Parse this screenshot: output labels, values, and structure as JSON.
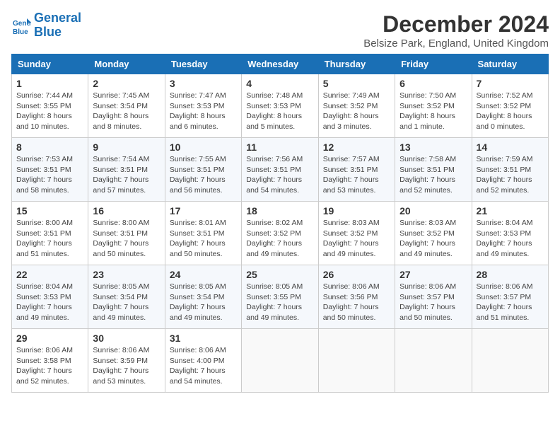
{
  "logo": {
    "line1": "General",
    "line2": "Blue"
  },
  "title": "December 2024",
  "subtitle": "Belsize Park, England, United Kingdom",
  "days_of_week": [
    "Sunday",
    "Monday",
    "Tuesday",
    "Wednesday",
    "Thursday",
    "Friday",
    "Saturday"
  ],
  "weeks": [
    [
      {
        "day": 1,
        "info": "Sunrise: 7:44 AM\nSunset: 3:55 PM\nDaylight: 8 hours\nand 10 minutes."
      },
      {
        "day": 2,
        "info": "Sunrise: 7:45 AM\nSunset: 3:54 PM\nDaylight: 8 hours\nand 8 minutes."
      },
      {
        "day": 3,
        "info": "Sunrise: 7:47 AM\nSunset: 3:53 PM\nDaylight: 8 hours\nand 6 minutes."
      },
      {
        "day": 4,
        "info": "Sunrise: 7:48 AM\nSunset: 3:53 PM\nDaylight: 8 hours\nand 5 minutes."
      },
      {
        "day": 5,
        "info": "Sunrise: 7:49 AM\nSunset: 3:52 PM\nDaylight: 8 hours\nand 3 minutes."
      },
      {
        "day": 6,
        "info": "Sunrise: 7:50 AM\nSunset: 3:52 PM\nDaylight: 8 hours\nand 1 minute."
      },
      {
        "day": 7,
        "info": "Sunrise: 7:52 AM\nSunset: 3:52 PM\nDaylight: 8 hours\nand 0 minutes."
      }
    ],
    [
      {
        "day": 8,
        "info": "Sunrise: 7:53 AM\nSunset: 3:51 PM\nDaylight: 7 hours\nand 58 minutes."
      },
      {
        "day": 9,
        "info": "Sunrise: 7:54 AM\nSunset: 3:51 PM\nDaylight: 7 hours\nand 57 minutes."
      },
      {
        "day": 10,
        "info": "Sunrise: 7:55 AM\nSunset: 3:51 PM\nDaylight: 7 hours\nand 56 minutes."
      },
      {
        "day": 11,
        "info": "Sunrise: 7:56 AM\nSunset: 3:51 PM\nDaylight: 7 hours\nand 54 minutes."
      },
      {
        "day": 12,
        "info": "Sunrise: 7:57 AM\nSunset: 3:51 PM\nDaylight: 7 hours\nand 53 minutes."
      },
      {
        "day": 13,
        "info": "Sunrise: 7:58 AM\nSunset: 3:51 PM\nDaylight: 7 hours\nand 52 minutes."
      },
      {
        "day": 14,
        "info": "Sunrise: 7:59 AM\nSunset: 3:51 PM\nDaylight: 7 hours\nand 52 minutes."
      }
    ],
    [
      {
        "day": 15,
        "info": "Sunrise: 8:00 AM\nSunset: 3:51 PM\nDaylight: 7 hours\nand 51 minutes."
      },
      {
        "day": 16,
        "info": "Sunrise: 8:00 AM\nSunset: 3:51 PM\nDaylight: 7 hours\nand 50 minutes."
      },
      {
        "day": 17,
        "info": "Sunrise: 8:01 AM\nSunset: 3:51 PM\nDaylight: 7 hours\nand 50 minutes."
      },
      {
        "day": 18,
        "info": "Sunrise: 8:02 AM\nSunset: 3:52 PM\nDaylight: 7 hours\nand 49 minutes."
      },
      {
        "day": 19,
        "info": "Sunrise: 8:03 AM\nSunset: 3:52 PM\nDaylight: 7 hours\nand 49 minutes."
      },
      {
        "day": 20,
        "info": "Sunrise: 8:03 AM\nSunset: 3:52 PM\nDaylight: 7 hours\nand 49 minutes."
      },
      {
        "day": 21,
        "info": "Sunrise: 8:04 AM\nSunset: 3:53 PM\nDaylight: 7 hours\nand 49 minutes."
      }
    ],
    [
      {
        "day": 22,
        "info": "Sunrise: 8:04 AM\nSunset: 3:53 PM\nDaylight: 7 hours\nand 49 minutes."
      },
      {
        "day": 23,
        "info": "Sunrise: 8:05 AM\nSunset: 3:54 PM\nDaylight: 7 hours\nand 49 minutes."
      },
      {
        "day": 24,
        "info": "Sunrise: 8:05 AM\nSunset: 3:54 PM\nDaylight: 7 hours\nand 49 minutes."
      },
      {
        "day": 25,
        "info": "Sunrise: 8:05 AM\nSunset: 3:55 PM\nDaylight: 7 hours\nand 49 minutes."
      },
      {
        "day": 26,
        "info": "Sunrise: 8:06 AM\nSunset: 3:56 PM\nDaylight: 7 hours\nand 50 minutes."
      },
      {
        "day": 27,
        "info": "Sunrise: 8:06 AM\nSunset: 3:57 PM\nDaylight: 7 hours\nand 50 minutes."
      },
      {
        "day": 28,
        "info": "Sunrise: 8:06 AM\nSunset: 3:57 PM\nDaylight: 7 hours\nand 51 minutes."
      }
    ],
    [
      {
        "day": 29,
        "info": "Sunrise: 8:06 AM\nSunset: 3:58 PM\nDaylight: 7 hours\nand 52 minutes."
      },
      {
        "day": 30,
        "info": "Sunrise: 8:06 AM\nSunset: 3:59 PM\nDaylight: 7 hours\nand 53 minutes."
      },
      {
        "day": 31,
        "info": "Sunrise: 8:06 AM\nSunset: 4:00 PM\nDaylight: 7 hours\nand 54 minutes."
      },
      null,
      null,
      null,
      null
    ]
  ]
}
